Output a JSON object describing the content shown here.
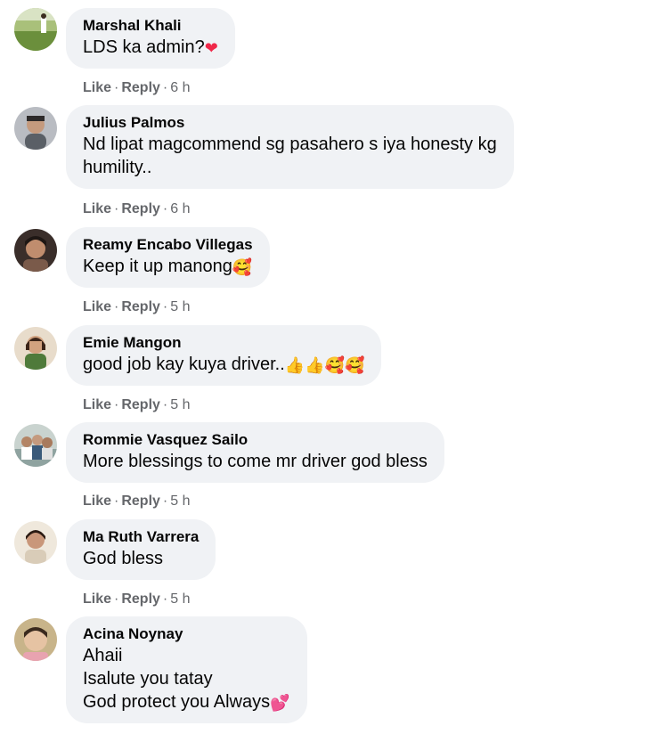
{
  "comments": [
    {
      "author": "Marshal Khali",
      "lines": [
        "LDS ka admin?"
      ],
      "trailing_emoji": "❤",
      "like": "Like",
      "reply": "Reply",
      "sep": "·",
      "time": "6 h",
      "avatar_color": "#6b8f3c"
    },
    {
      "author": "Julius Palmos",
      "lines": [
        "Nd lipat magcommend sg pasahero s iya honesty kg",
        "humility.."
      ],
      "like": "Like",
      "reply": "Reply",
      "sep": "·",
      "time": "6 h",
      "avatar_color": "#8a8f96"
    },
    {
      "author": "Reamy Encabo Villegas",
      "lines": [
        "Keep it up manong"
      ],
      "trailing_emoji": "🥰",
      "like": "Like",
      "reply": "Reply",
      "sep": "·",
      "time": "5 h",
      "avatar_color": "#4a3a32"
    },
    {
      "author": "Emie Mangon",
      "lines": [
        "good job kay kuya driver.."
      ],
      "trailing_emoji": "👍👍🥰🥰",
      "like": "Like",
      "reply": "Reply",
      "sep": "·",
      "time": "5 h",
      "avatar_color": "#c9a37a"
    },
    {
      "author": "Rommie Vasquez Sailo",
      "lines": [
        "More blessings to come mr driver god bless"
      ],
      "like": "Like",
      "reply": "Reply",
      "sep": "·",
      "time": "5 h",
      "avatar_color": "#8fa3a0"
    },
    {
      "author": "Ma Ruth Varrera",
      "lines": [
        "God bless"
      ],
      "like": "Like",
      "reply": "Reply",
      "sep": "·",
      "time": "5 h",
      "avatar_color": "#d9ccb8"
    },
    {
      "author": "Acina Noynay",
      "lines": [
        "Ahaii",
        "Isalute you tatay",
        "God protect you Always"
      ],
      "trailing_emoji": "💕",
      "avatar_color": "#c8b48a"
    }
  ],
  "colors": {
    "bubble_bg": "#f0f2f5",
    "meta_text": "#65676b",
    "heart_red": "#f02849"
  }
}
